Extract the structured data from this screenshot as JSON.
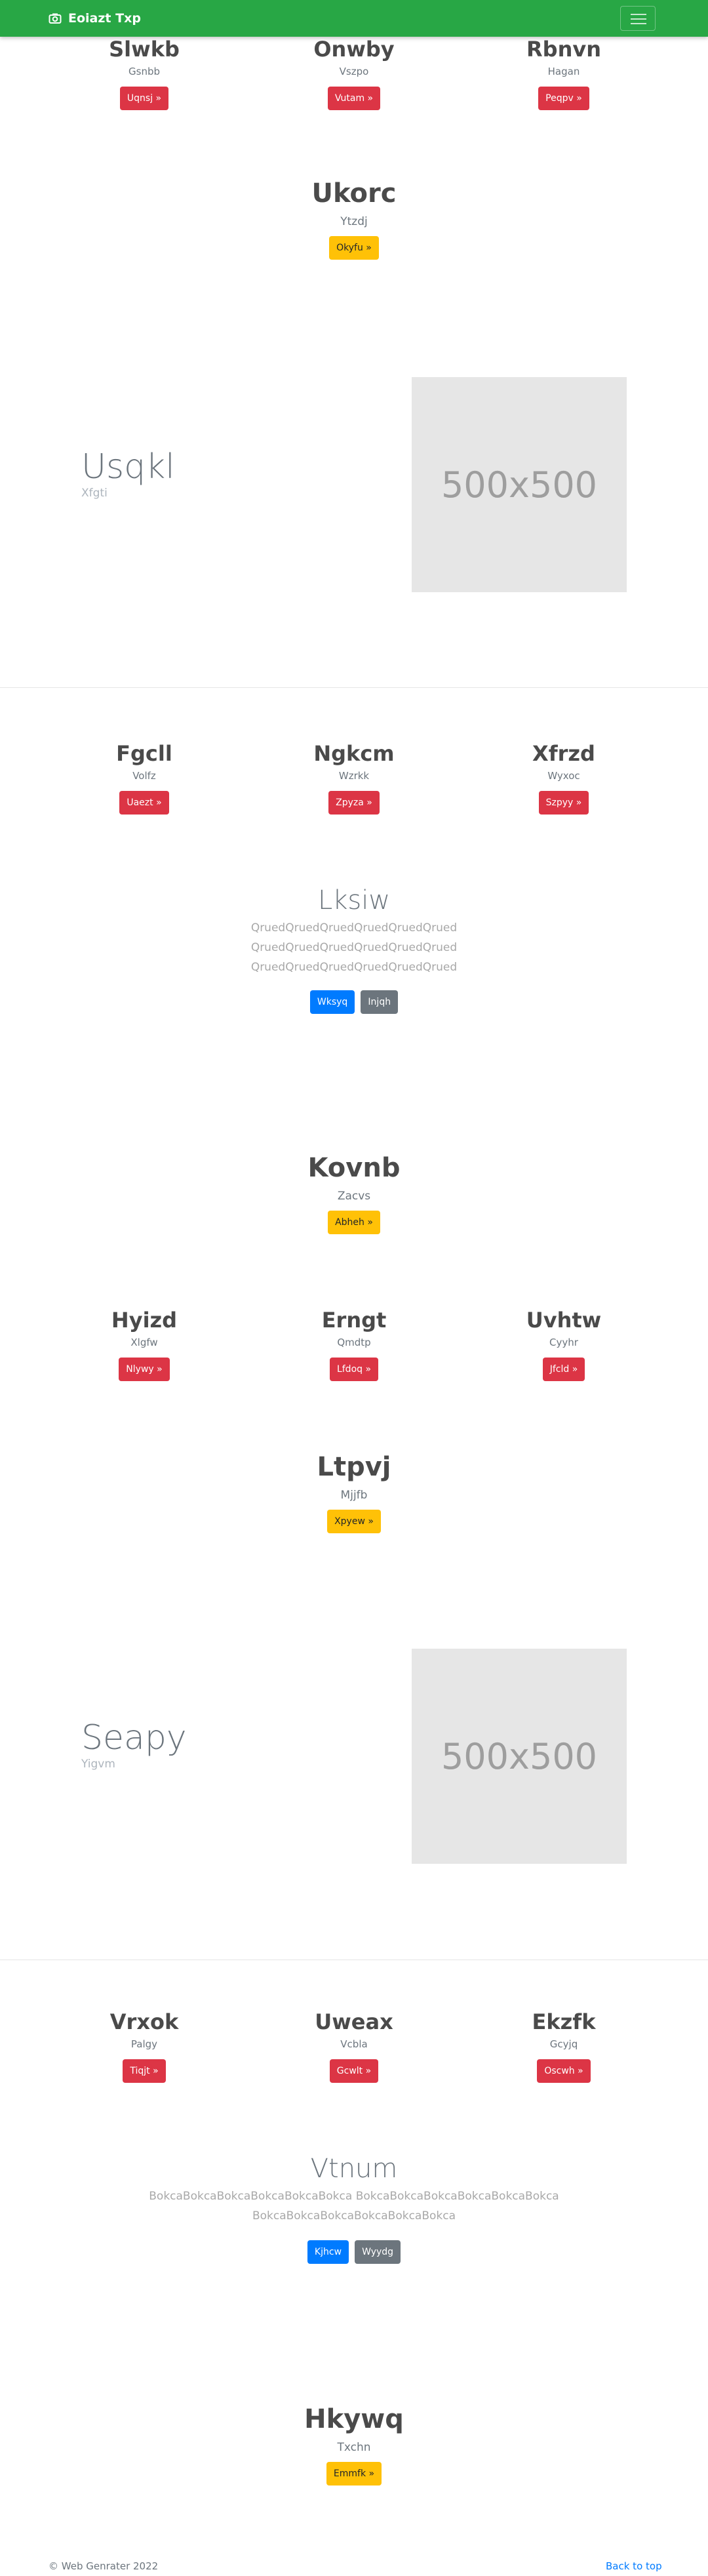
{
  "navbar": {
    "brand": "Eoiazt Txp"
  },
  "row1": [
    {
      "title": "Slwkb",
      "sub": "Gsnbb",
      "btn": "Uqnsj »"
    },
    {
      "title": "Onwby",
      "sub": "Vszpo",
      "btn": "Vutam »"
    },
    {
      "title": "Rbnvn",
      "sub": "Hagan",
      "btn": "Peqpv »"
    }
  ],
  "center1": {
    "title": "Ukorc",
    "sub": "Ytzdj",
    "btn": "Okyfu »"
  },
  "feature1": {
    "title": "Usqkl",
    "sub": "Xfgti",
    "image": "500x500"
  },
  "row2": [
    {
      "title": "Fgcll",
      "sub": "Volfz",
      "btn": "Uaezt »"
    },
    {
      "title": "Ngkcm",
      "sub": "Wzrkk",
      "btn": "Zpyza »"
    },
    {
      "title": "Xfrzd",
      "sub": "Wyxoc",
      "btn": "Szpyy »"
    }
  ],
  "marketing1": {
    "title": "Lksiw",
    "lines": [
      "QruedQruedQruedQruedQruedQrued",
      "QruedQruedQruedQruedQruedQrued",
      "QruedQruedQruedQruedQruedQrued"
    ],
    "btn_primary": "Wksyq",
    "btn_secondary": "Injqh"
  },
  "center2": {
    "title": "Kovnb",
    "sub": "Zacvs",
    "btn": "Abheh »"
  },
  "row3": [
    {
      "title": "Hyizd",
      "sub": "Xlgfw",
      "btn": "Nlywy »"
    },
    {
      "title": "Erngt",
      "sub": "Qmdtp",
      "btn": "Lfdoq »"
    },
    {
      "title": "Uvhtw",
      "sub": "Cyyhr",
      "btn": "Jfcld »"
    }
  ],
  "center3": {
    "title": "Ltpvj",
    "sub": "Mjjfb",
    "btn": "Xpyew »"
  },
  "feature2": {
    "title": "Seapy",
    "sub": "Yigvm",
    "image": "500x500"
  },
  "row4": [
    {
      "title": "Vrxok",
      "sub": "Palgy",
      "btn": "Tiqjt »"
    },
    {
      "title": "Uweax",
      "sub": "Vcbla",
      "btn": "Gcwlt »"
    },
    {
      "title": "Ekzfk",
      "sub": "Gcyjq",
      "btn": "Oscwh »"
    }
  ],
  "marketing2": {
    "title": "Vtnum",
    "lines": [
      "BokcaBokcaBokcaBokcaBokcaBokca BokcaBokcaBokcaBokcaBokcaBokca",
      "BokcaBokcaBokcaBokcaBokcaBokca"
    ],
    "btn_primary": "Kjhcw",
    "btn_secondary": "Wyydg"
  },
  "center4": {
    "title": "Hkywq",
    "sub": "Txchn",
    "btn": "Emmfk »"
  },
  "footer": {
    "copyright": "© Web Genrater 2022",
    "back_to_top": "Back to top"
  },
  "colors": {
    "navbar": "#28a745",
    "danger": "#dc3545",
    "warning": "#ffc107",
    "primary": "#007bff",
    "secondary": "#6c757d"
  }
}
